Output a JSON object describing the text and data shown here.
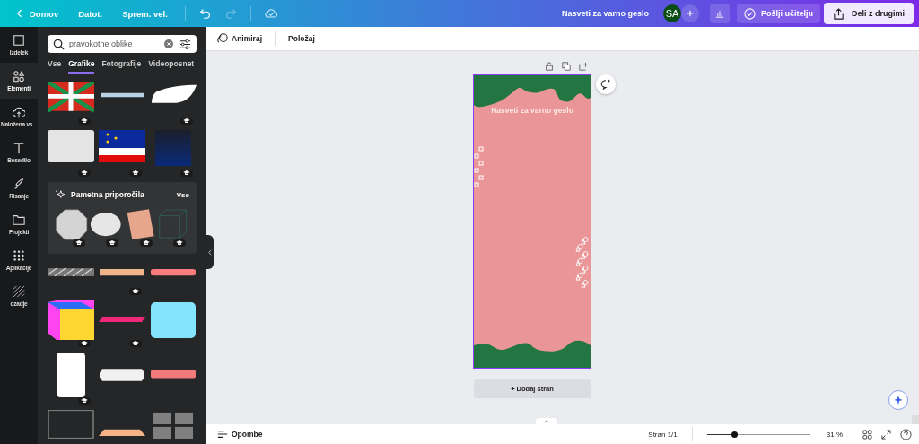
{
  "topbar": {
    "nav": [
      {
        "label": "Domov",
        "kind": "back"
      },
      {
        "label": "Datot.",
        "kind": "plain"
      },
      {
        "label": "Sprem. vel.",
        "kind": "plain"
      }
    ],
    "undo": {
      "disabled": false
    },
    "redo": {
      "disabled": true
    },
    "title": "Nasveti za varno geslo",
    "avatar": "SA",
    "send_button": "Pošlji učitelju",
    "share_button": "Deli z drugimi"
  },
  "rail": [
    {
      "label": "Izdelek",
      "selected": false
    },
    {
      "label": "Elementi",
      "selected": true
    },
    {
      "label": "Naložena vs...",
      "selected": false
    },
    {
      "label": "Besedilo",
      "selected": false
    },
    {
      "label": "Risanje",
      "selected": false
    },
    {
      "label": "Projekti",
      "selected": false
    },
    {
      "label": "Aplikacije",
      "selected": false
    },
    {
      "label": "ozadje",
      "selected": false
    }
  ],
  "panel": {
    "search": {
      "value": "pravokotne oblike"
    },
    "tabs": [
      {
        "label": "Vse",
        "selected": false
      },
      {
        "label": "Grafike",
        "selected": true
      },
      {
        "label": "Fotografije",
        "selected": false
      },
      {
        "label": "Videoposnet",
        "selected": false
      }
    ],
    "rows_top": [
      {
        "items": [
          {
            "kind": "basque",
            "premium": true
          },
          {
            "kind": "stroke",
            "premium": false
          },
          {
            "kind": "leaf",
            "premium": true
          }
        ]
      },
      {
        "items": [
          {
            "kind": "tile",
            "premium": true
          },
          {
            "kind": "stars",
            "premium": true
          },
          {
            "kind": "gradient",
            "premium": true
          }
        ]
      }
    ],
    "recommend": {
      "title": "Pametna priporočila",
      "all": "Vse",
      "items": [
        {
          "kind": "octagon",
          "premium": true
        },
        {
          "kind": "ellipse",
          "premium": true
        },
        {
          "kind": "paper",
          "premium": true
        },
        {
          "kind": "box",
          "premium": true
        }
      ]
    },
    "rows_bottom": [
      {
        "items": [
          {
            "kind": "hatch",
            "premium": false
          },
          {
            "kind": "ribbon",
            "premium": true
          },
          {
            "kind": "bar",
            "premium": false
          }
        ]
      },
      {
        "items": [
          {
            "kind": "cube",
            "premium": true
          },
          {
            "kind": "strip",
            "premium": true
          },
          {
            "kind": "panel",
            "premium": false
          }
        ]
      },
      {
        "items": [
          {
            "kind": "card",
            "premium": true
          },
          {
            "kind": "tag",
            "premium": false
          },
          {
            "kind": "band",
            "premium": false
          }
        ]
      },
      {
        "items": [
          {
            "kind": "frame",
            "premium": false
          },
          {
            "kind": "tray",
            "premium": false
          },
          {
            "kind": "grid",
            "premium": false
          }
        ]
      }
    ]
  },
  "toolbar": {
    "animate": "Animiraj",
    "position": "Položaj"
  },
  "design": {
    "title": "Nasveti za varno geslo",
    "add_page": "+ Dodaj stran"
  },
  "footer": {
    "notes": "Opombe",
    "page": "Stran 1/1",
    "zoom": {
      "level": 0.26,
      "reading": "31 %"
    }
  }
}
